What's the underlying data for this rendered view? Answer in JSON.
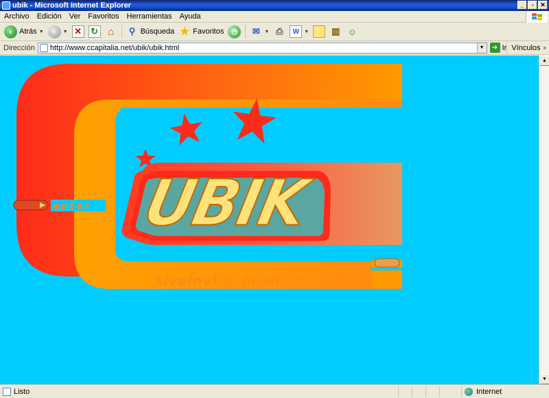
{
  "window": {
    "title": "ubik - Microsoft Internet Explorer",
    "min": "_",
    "max": "▫",
    "close": "✕"
  },
  "menu": [
    "Archivo",
    "Edición",
    "Ver",
    "Favoritos",
    "Herramientas",
    "Ayuda"
  ],
  "toolbar": {
    "back_label": "Atrás",
    "search_label": "Búsqueda",
    "favorites_label": "Favoritos"
  },
  "address": {
    "label": "Dirección",
    "url": "http://www.ccapitalia.net/ubik/ubik.html",
    "go_label": "Ir",
    "links_label": "Vínculos"
  },
  "page": {
    "logo_text": "UBIK",
    "enter_text": "enter",
    "email_text": "sivainvi @ mixmail.com"
  },
  "status": {
    "text": "Listo",
    "zone": "Internet"
  },
  "colors": {
    "page_bg": "#00ccff",
    "logo_red": "#ff2a1a",
    "logo_orange": "#ff9900",
    "logo_teal": "#5aa6a0",
    "logo_yellow": "#ffe27a"
  }
}
